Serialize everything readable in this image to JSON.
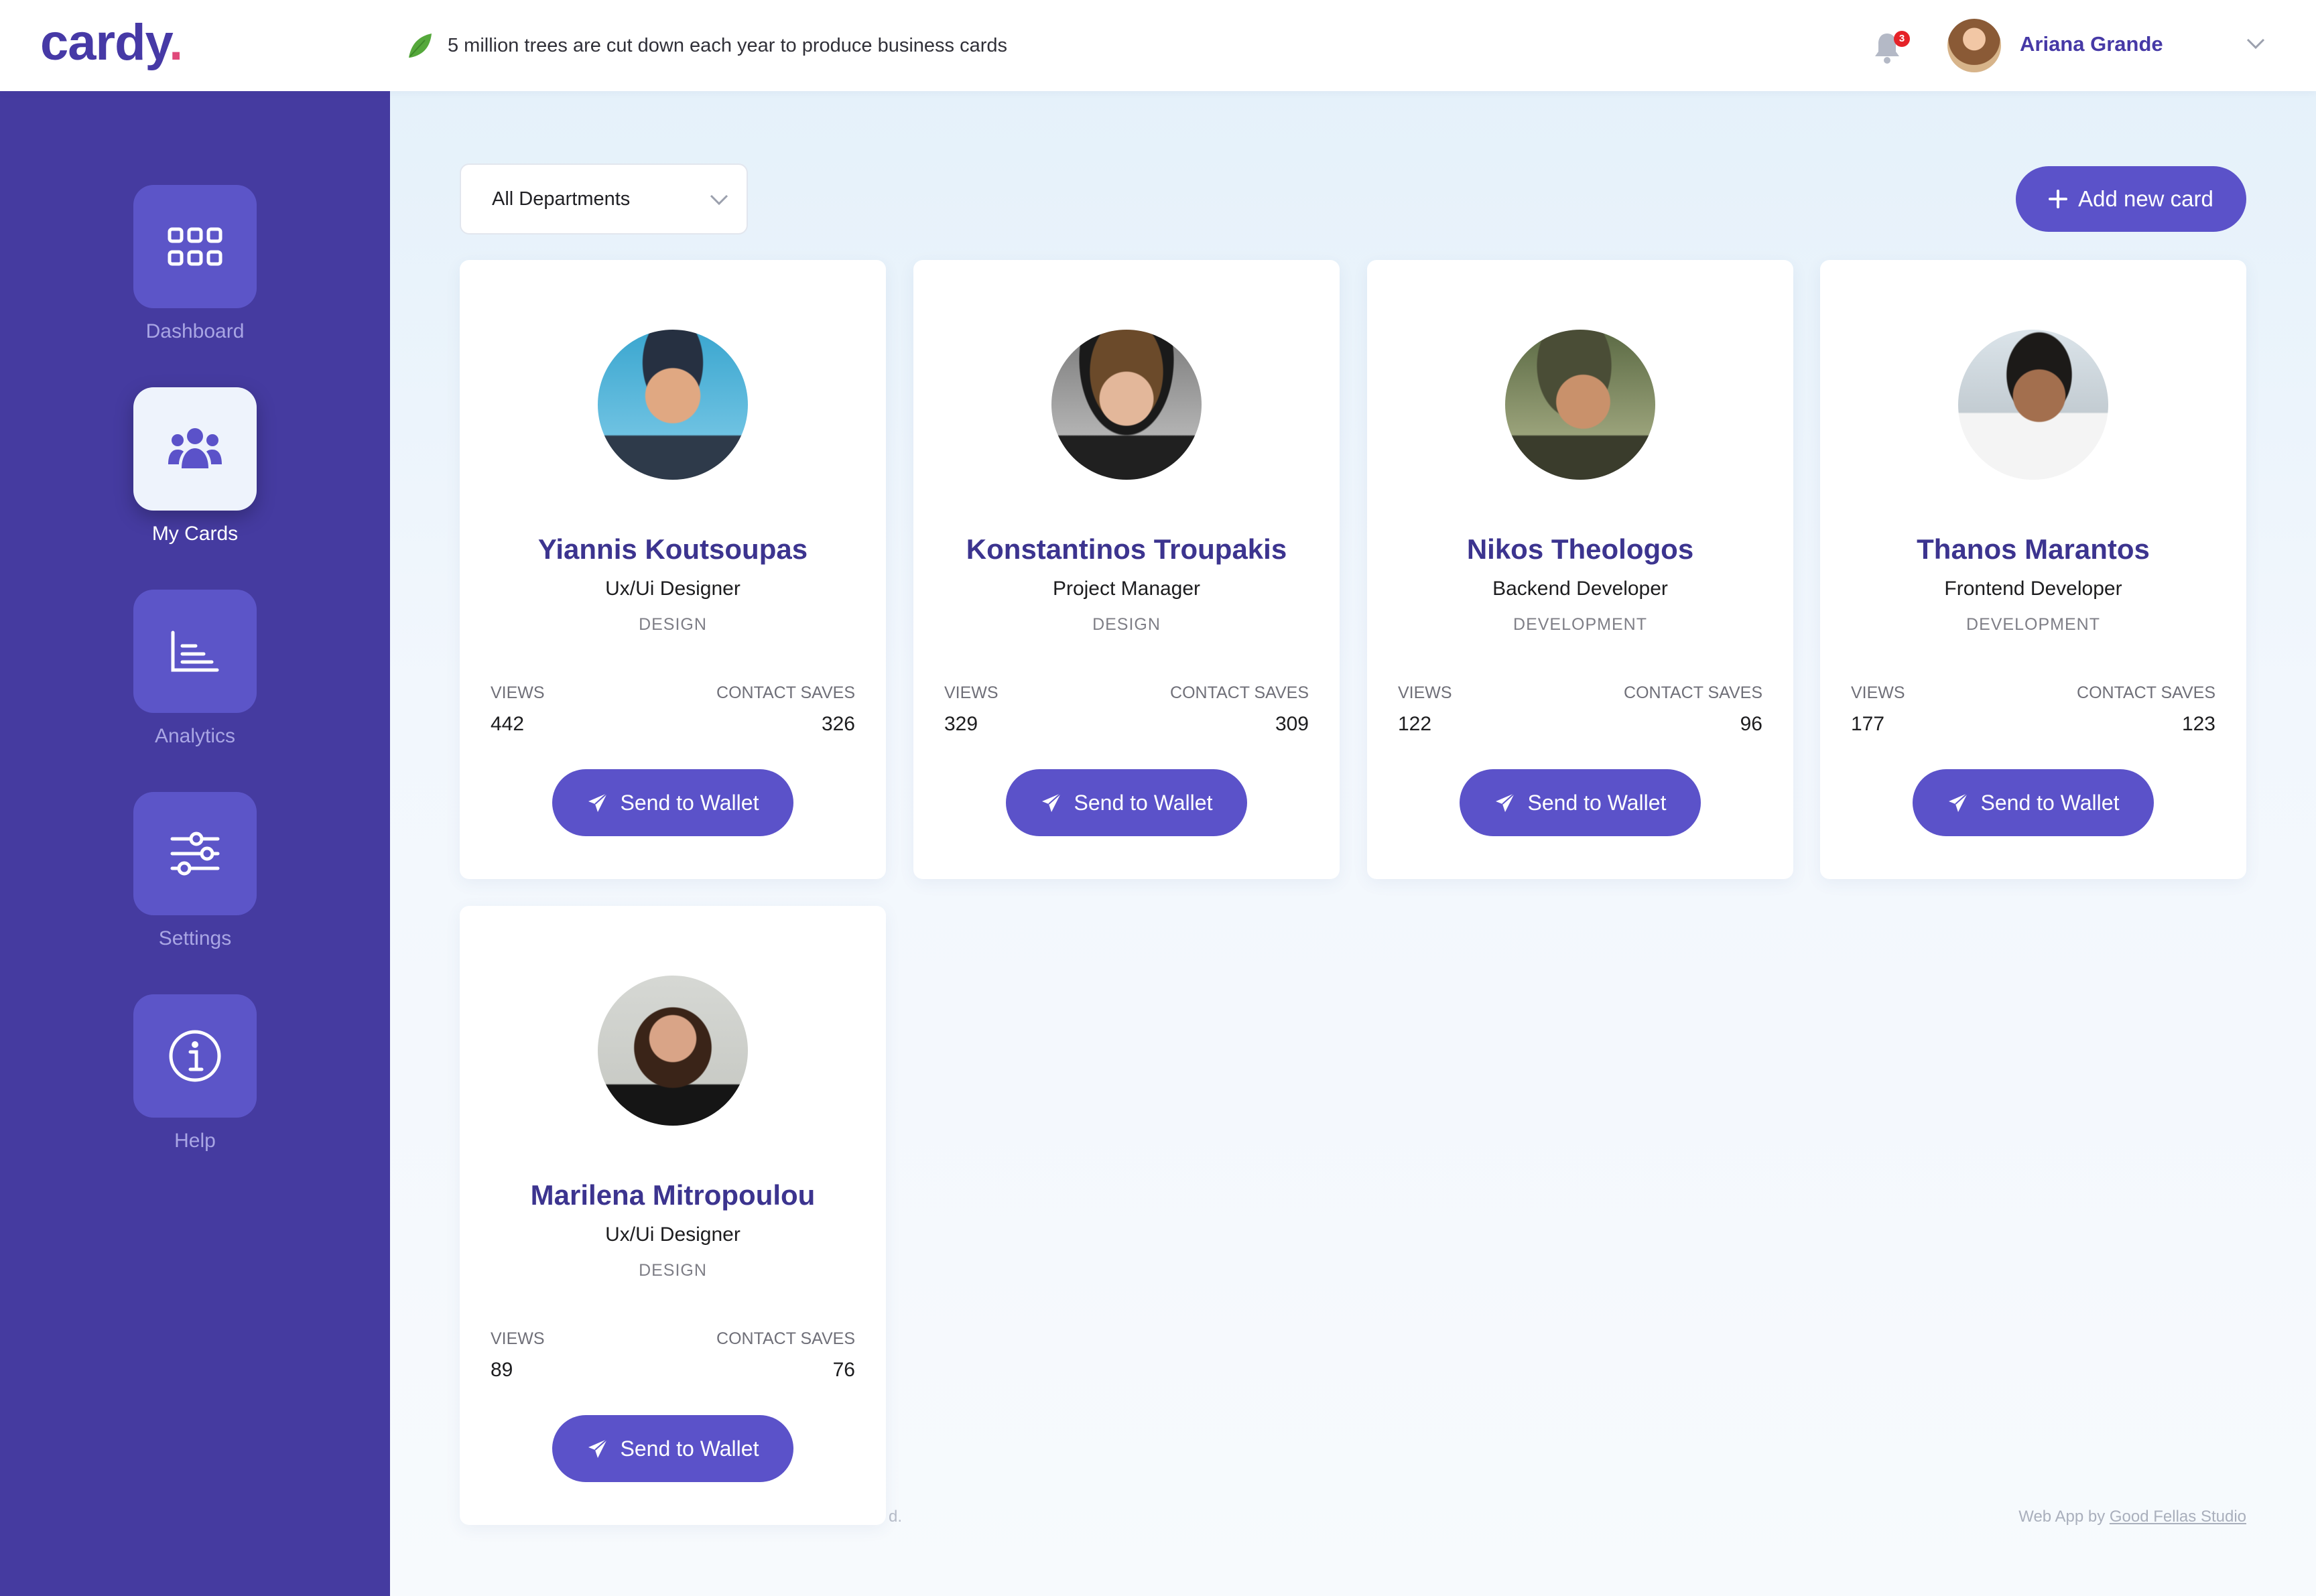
{
  "brand": {
    "name": "cardy",
    "dot": ".",
    "accent": "#4639a6",
    "dot_color": "#e0497a"
  },
  "header": {
    "tip": "5 million trees are cut down each year to produce business cards",
    "notifications": "3",
    "user_name": "Ariana Grande"
  },
  "sidebar": {
    "items": [
      {
        "label": "Dashboard",
        "icon": "grid-icon",
        "active": false
      },
      {
        "label": "My Cards",
        "icon": "users-icon",
        "active": true
      },
      {
        "label": "Analytics",
        "icon": "chart-icon",
        "active": false
      },
      {
        "label": "Settings",
        "icon": "sliders-icon",
        "active": false
      },
      {
        "label": "Help",
        "icon": "info-icon",
        "active": false
      }
    ]
  },
  "filter": {
    "selected": "All Departments"
  },
  "actions": {
    "add_card": "Add new card"
  },
  "stats_labels": {
    "views": "VIEWS",
    "saves": "CONTACT SAVES"
  },
  "send_label": "Send to Wallet",
  "cards": [
    {
      "name": "Yiannis Koutsoupas",
      "role": "Ux/Ui Designer",
      "department": "DESIGN",
      "views": "442",
      "saves": "326"
    },
    {
      "name": "Konstantinos Troupakis",
      "role": "Project Manager",
      "department": "DESIGN",
      "views": "329",
      "saves": "309"
    },
    {
      "name": "Nikos Theologos",
      "role": "Backend Developer",
      "department": "DEVELOPMENT",
      "views": "122",
      "saves": "96"
    },
    {
      "name": "Thanos Marantos",
      "role": "Frontend Developer",
      "department": "DEVELOPMENT",
      "views": "177",
      "saves": "123"
    },
    {
      "name": "Marilena Mitropoulou",
      "role": "Ux/Ui Designer",
      "department": "DESIGN",
      "views": "89",
      "saves": "76"
    }
  ],
  "footer": {
    "left": "d.",
    "right_prefix": "Web App by ",
    "right_link": "Good Fellas Studio"
  }
}
